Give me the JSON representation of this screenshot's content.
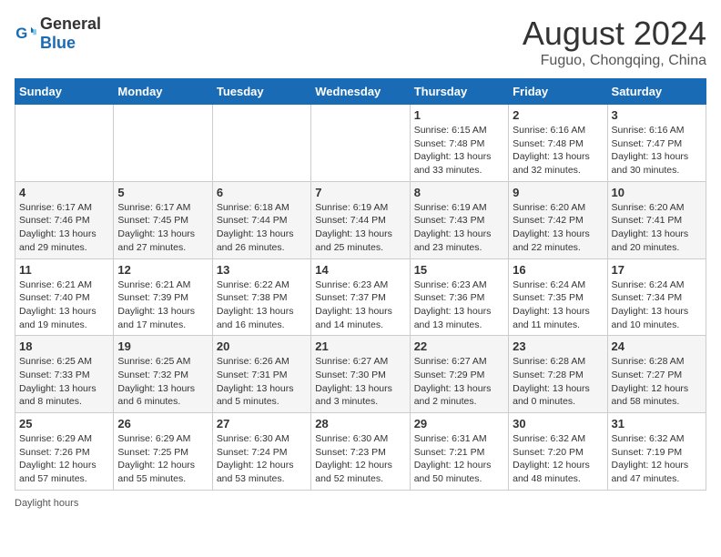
{
  "header": {
    "logo_general": "General",
    "logo_blue": "Blue",
    "title": "August 2024",
    "subtitle": "Fuguo, Chongqing, China"
  },
  "calendar": {
    "days_of_week": [
      "Sunday",
      "Monday",
      "Tuesday",
      "Wednesday",
      "Thursday",
      "Friday",
      "Saturday"
    ],
    "weeks": [
      [
        {
          "day": "",
          "detail": ""
        },
        {
          "day": "",
          "detail": ""
        },
        {
          "day": "",
          "detail": ""
        },
        {
          "day": "",
          "detail": ""
        },
        {
          "day": "1",
          "detail": "Sunrise: 6:15 AM\nSunset: 7:48 PM\nDaylight: 13 hours and 33 minutes."
        },
        {
          "day": "2",
          "detail": "Sunrise: 6:16 AM\nSunset: 7:48 PM\nDaylight: 13 hours and 32 minutes."
        },
        {
          "day": "3",
          "detail": "Sunrise: 6:16 AM\nSunset: 7:47 PM\nDaylight: 13 hours and 30 minutes."
        }
      ],
      [
        {
          "day": "4",
          "detail": "Sunrise: 6:17 AM\nSunset: 7:46 PM\nDaylight: 13 hours and 29 minutes."
        },
        {
          "day": "5",
          "detail": "Sunrise: 6:17 AM\nSunset: 7:45 PM\nDaylight: 13 hours and 27 minutes."
        },
        {
          "day": "6",
          "detail": "Sunrise: 6:18 AM\nSunset: 7:44 PM\nDaylight: 13 hours and 26 minutes."
        },
        {
          "day": "7",
          "detail": "Sunrise: 6:19 AM\nSunset: 7:44 PM\nDaylight: 13 hours and 25 minutes."
        },
        {
          "day": "8",
          "detail": "Sunrise: 6:19 AM\nSunset: 7:43 PM\nDaylight: 13 hours and 23 minutes."
        },
        {
          "day": "9",
          "detail": "Sunrise: 6:20 AM\nSunset: 7:42 PM\nDaylight: 13 hours and 22 minutes."
        },
        {
          "day": "10",
          "detail": "Sunrise: 6:20 AM\nSunset: 7:41 PM\nDaylight: 13 hours and 20 minutes."
        }
      ],
      [
        {
          "day": "11",
          "detail": "Sunrise: 6:21 AM\nSunset: 7:40 PM\nDaylight: 13 hours and 19 minutes."
        },
        {
          "day": "12",
          "detail": "Sunrise: 6:21 AM\nSunset: 7:39 PM\nDaylight: 13 hours and 17 minutes."
        },
        {
          "day": "13",
          "detail": "Sunrise: 6:22 AM\nSunset: 7:38 PM\nDaylight: 13 hours and 16 minutes."
        },
        {
          "day": "14",
          "detail": "Sunrise: 6:23 AM\nSunset: 7:37 PM\nDaylight: 13 hours and 14 minutes."
        },
        {
          "day": "15",
          "detail": "Sunrise: 6:23 AM\nSunset: 7:36 PM\nDaylight: 13 hours and 13 minutes."
        },
        {
          "day": "16",
          "detail": "Sunrise: 6:24 AM\nSunset: 7:35 PM\nDaylight: 13 hours and 11 minutes."
        },
        {
          "day": "17",
          "detail": "Sunrise: 6:24 AM\nSunset: 7:34 PM\nDaylight: 13 hours and 10 minutes."
        }
      ],
      [
        {
          "day": "18",
          "detail": "Sunrise: 6:25 AM\nSunset: 7:33 PM\nDaylight: 13 hours and 8 minutes."
        },
        {
          "day": "19",
          "detail": "Sunrise: 6:25 AM\nSunset: 7:32 PM\nDaylight: 13 hours and 6 minutes."
        },
        {
          "day": "20",
          "detail": "Sunrise: 6:26 AM\nSunset: 7:31 PM\nDaylight: 13 hours and 5 minutes."
        },
        {
          "day": "21",
          "detail": "Sunrise: 6:27 AM\nSunset: 7:30 PM\nDaylight: 13 hours and 3 minutes."
        },
        {
          "day": "22",
          "detail": "Sunrise: 6:27 AM\nSunset: 7:29 PM\nDaylight: 13 hours and 2 minutes."
        },
        {
          "day": "23",
          "detail": "Sunrise: 6:28 AM\nSunset: 7:28 PM\nDaylight: 13 hours and 0 minutes."
        },
        {
          "day": "24",
          "detail": "Sunrise: 6:28 AM\nSunset: 7:27 PM\nDaylight: 12 hours and 58 minutes."
        }
      ],
      [
        {
          "day": "25",
          "detail": "Sunrise: 6:29 AM\nSunset: 7:26 PM\nDaylight: 12 hours and 57 minutes."
        },
        {
          "day": "26",
          "detail": "Sunrise: 6:29 AM\nSunset: 7:25 PM\nDaylight: 12 hours and 55 minutes."
        },
        {
          "day": "27",
          "detail": "Sunrise: 6:30 AM\nSunset: 7:24 PM\nDaylight: 12 hours and 53 minutes."
        },
        {
          "day": "28",
          "detail": "Sunrise: 6:30 AM\nSunset: 7:23 PM\nDaylight: 12 hours and 52 minutes."
        },
        {
          "day": "29",
          "detail": "Sunrise: 6:31 AM\nSunset: 7:21 PM\nDaylight: 12 hours and 50 minutes."
        },
        {
          "day": "30",
          "detail": "Sunrise: 6:32 AM\nSunset: 7:20 PM\nDaylight: 12 hours and 48 minutes."
        },
        {
          "day": "31",
          "detail": "Sunrise: 6:32 AM\nSunset: 7:19 PM\nDaylight: 12 hours and 47 minutes."
        }
      ]
    ]
  },
  "footer": {
    "daylight_label": "Daylight hours"
  }
}
